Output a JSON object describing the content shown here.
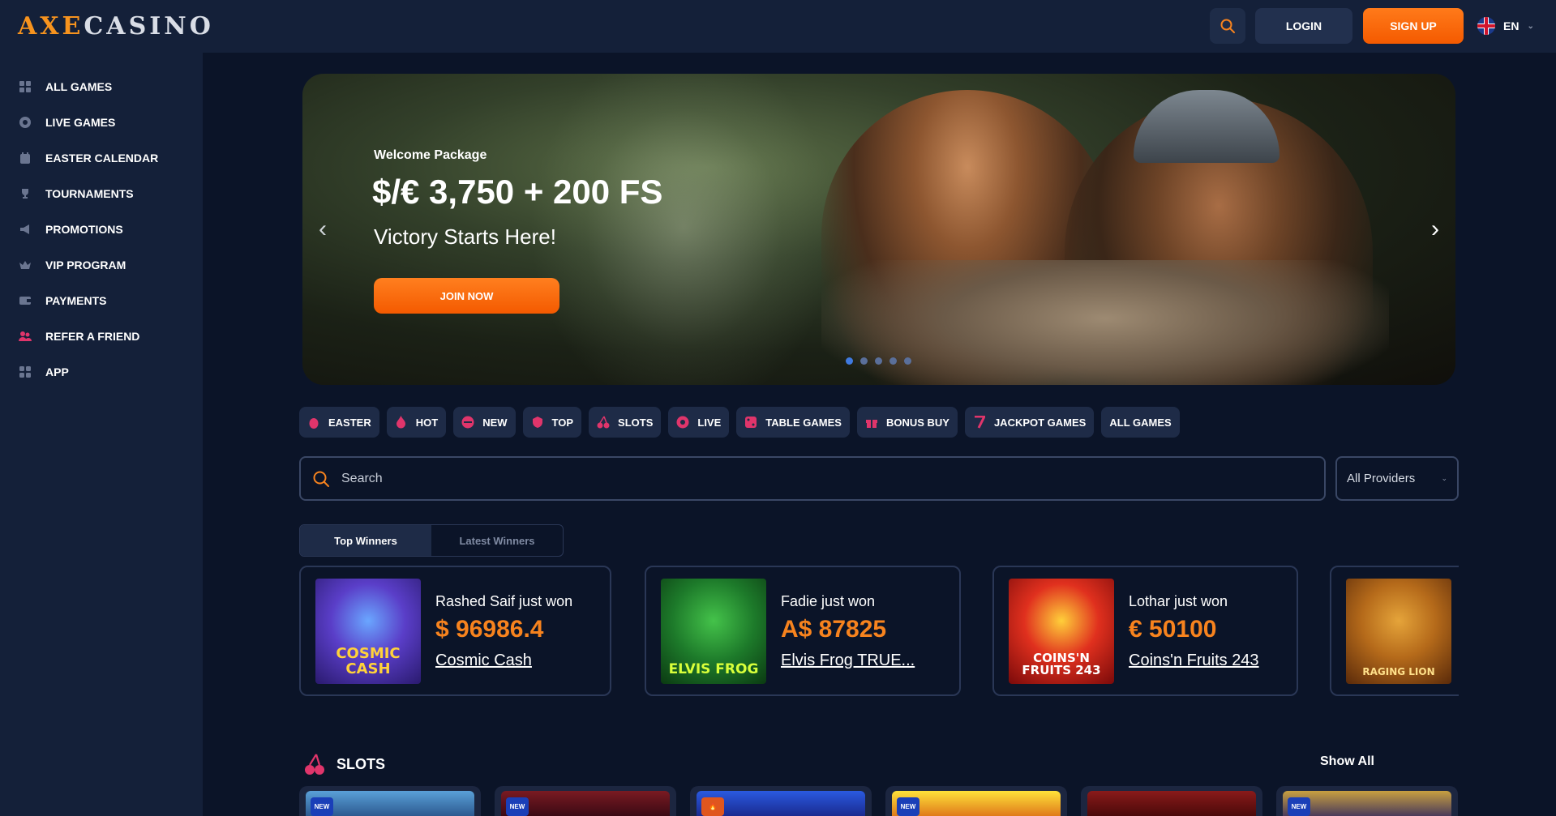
{
  "brand": {
    "part1": "AXE",
    "part2": "CASINO"
  },
  "header": {
    "login": "LOGIN",
    "signup": "SIGN UP",
    "language": "EN"
  },
  "sidebar": {
    "items": [
      {
        "label": "ALL GAMES",
        "icon": "cards-icon"
      },
      {
        "label": "LIVE GAMES",
        "icon": "chip-icon"
      },
      {
        "label": "EASTER CALENDAR",
        "icon": "calendar-icon"
      },
      {
        "label": "TOURNAMENTS",
        "icon": "trophy-icon"
      },
      {
        "label": "PROMOTIONS",
        "icon": "megaphone-icon"
      },
      {
        "label": "VIP PROGRAM",
        "icon": "crown-icon"
      },
      {
        "label": "PAYMENTS",
        "icon": "wallet-icon"
      },
      {
        "label": "REFER A FRIEND",
        "icon": "users-icon"
      },
      {
        "label": "APP",
        "icon": "grid-icon"
      }
    ]
  },
  "banner": {
    "welcome": "Welcome Package",
    "amount": "$/€ 3,750 + 200 FS",
    "tagline": "Victory Starts Here!",
    "cta": "JOIN NOW",
    "slides": 5,
    "active_slide": 1
  },
  "categories": [
    {
      "label": "EASTER",
      "icon": "egg-icon"
    },
    {
      "label": "HOT",
      "icon": "flame-icon"
    },
    {
      "label": "NEW",
      "icon": "new-icon"
    },
    {
      "label": "TOP",
      "icon": "shield-icon"
    },
    {
      "label": "SLOTS",
      "icon": "cherry-icon"
    },
    {
      "label": "LIVE",
      "icon": "chip-icon"
    },
    {
      "label": "TABLE GAMES",
      "icon": "dice-icon"
    },
    {
      "label": "BONUS BUY",
      "icon": "gift-icon"
    },
    {
      "label": "JACKPOT GAMES",
      "icon": "seven-icon"
    },
    {
      "label": "ALL GAMES",
      "icon": ""
    }
  ],
  "search": {
    "placeholder": "Search",
    "providers": "All Providers"
  },
  "winner_tabs": {
    "top": "Top Winners",
    "latest": "Latest Winners"
  },
  "winners": [
    {
      "who": "Rashed Saif just won",
      "amount": "$ 96986.4",
      "game": "Cosmic Cash",
      "thumb_label": "COSMIC CASH"
    },
    {
      "who": "Fadie just won",
      "amount": "A$ 87825",
      "game": "Elvis Frog TRUE...",
      "thumb_label": "ELVIS FROG"
    },
    {
      "who": "Lothar just won",
      "amount": "€ 50100",
      "game": "Coins'n Fruits 243",
      "thumb_label": "COINS'N FRUITS 243"
    },
    {
      "who": "",
      "amount": "",
      "game": "",
      "thumb_label": "RAGING LION"
    }
  ],
  "slots": {
    "title": "SLOTS",
    "show_all": "Show All",
    "new_badge": "NEW"
  },
  "colors": {
    "accent": "#f7831e",
    "bg": "#0b1428",
    "panel": "#142039",
    "chip": "#1e2b47",
    "icon_pink": "#e0356b"
  }
}
